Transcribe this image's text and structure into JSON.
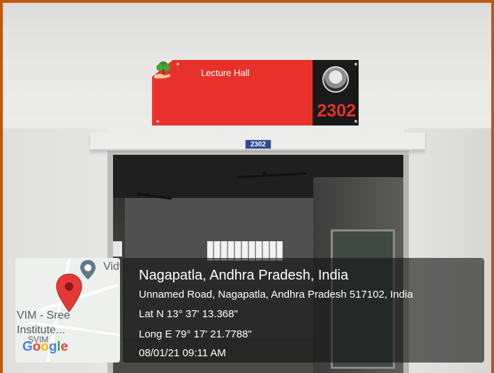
{
  "sign": {
    "title": "Lecture Hall",
    "room_number": "2302"
  },
  "door_plate": {
    "number": "2302"
  },
  "map_thumbnail": {
    "poi_label": "Vidy",
    "place_label_1": "VIM - Sree",
    "place_label_2": "Institute...",
    "place_label_3": "SVIM",
    "google_letters": [
      "G",
      "o",
      "o",
      "g",
      "l",
      "e"
    ],
    "google_colors": [
      "#4285F4",
      "#EA4335",
      "#FBBC05",
      "#4285F4",
      "#34A853",
      "#EA4335"
    ],
    "pin_color": "#e53935"
  },
  "location": {
    "title": "Nagapatla, Andhra Pradesh, India",
    "address": "Unnamed Road, Nagapatla, Andhra Pradesh 517102, India",
    "latitude": "Lat N 13° 37' 13.368\"",
    "longitude": "Long E 79° 17' 21.7788\"",
    "timestamp": "08/01/21 09:11 AM"
  },
  "colors": {
    "frame": "#c2560f",
    "sign_red": "#e8312a",
    "sign_black": "#1a1a1a"
  }
}
